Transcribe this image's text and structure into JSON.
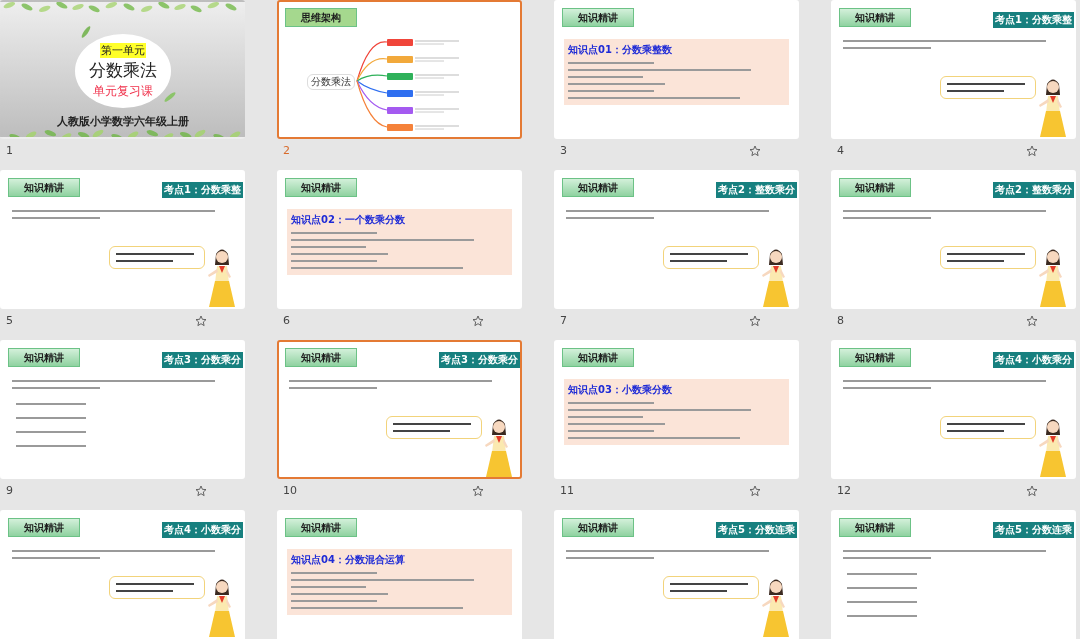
{
  "slides": [
    {
      "number": "1",
      "kind": "title",
      "selected": false,
      "current": false,
      "animated": false,
      "unit": "第一单元",
      "title": "分数乘法",
      "subtitle": "单元复习课",
      "book": "人教版小学数学六年级上册"
    },
    {
      "number": "2",
      "kind": "mindmap",
      "selected": true,
      "current": true,
      "animated": false,
      "header": "思维架构",
      "center": "分数乘法",
      "branches": [
        {
          "color": "#f0453a"
        },
        {
          "color": "#f2a93b"
        },
        {
          "color": "#2fb15a"
        },
        {
          "color": "#2f6ff0"
        },
        {
          "color": "#a45af0"
        },
        {
          "color": "#f5823a"
        }
      ]
    },
    {
      "number": "3",
      "kind": "knowledge",
      "selected": false,
      "current": false,
      "animated": true,
      "header": "知识精讲",
      "point": "知识点01：分数乘整数"
    },
    {
      "number": "4",
      "kind": "example",
      "selected": false,
      "current": false,
      "animated": true,
      "header": "知识精讲",
      "tag": "考点1：分数乘整",
      "figure": true
    },
    {
      "number": "5",
      "kind": "example",
      "selected": false,
      "current": false,
      "animated": true,
      "header": "知识精讲",
      "tag": "考点1：分数乘整",
      "figure": true
    },
    {
      "number": "6",
      "kind": "knowledge",
      "selected": false,
      "current": false,
      "animated": true,
      "header": "知识精讲",
      "point": "知识点02：一个数乘分数"
    },
    {
      "number": "7",
      "kind": "example",
      "selected": false,
      "current": false,
      "animated": true,
      "header": "知识精讲",
      "tag": "考点2：整数乘分",
      "figure": true
    },
    {
      "number": "8",
      "kind": "example",
      "selected": false,
      "current": false,
      "animated": true,
      "header": "知识精讲",
      "tag": "考点2：整数乘分",
      "figure": true
    },
    {
      "number": "9",
      "kind": "example",
      "selected": false,
      "current": false,
      "animated": true,
      "header": "知识精讲",
      "tag": "考点3：分数乘分",
      "figure": false
    },
    {
      "number": "10",
      "kind": "example",
      "selected": true,
      "current": false,
      "animated": true,
      "header": "知识精讲",
      "tag": "考点3：分数乘分",
      "figure": true
    },
    {
      "number": "11",
      "kind": "knowledge",
      "selected": false,
      "current": false,
      "animated": true,
      "header": "知识精讲",
      "point": "知识点03：小数乘分数"
    },
    {
      "number": "12",
      "kind": "example",
      "selected": false,
      "current": false,
      "animated": true,
      "header": "知识精讲",
      "tag": "考点4：小数乘分",
      "figure": true
    },
    {
      "kind": "example",
      "selected": false,
      "header": "知识精讲",
      "tag": "考点4：小数乘分",
      "figure": true
    },
    {
      "kind": "knowledge",
      "selected": false,
      "header": "知识精讲",
      "point": "知识点04：分数混合运算"
    },
    {
      "kind": "example",
      "selected": false,
      "header": "知识精讲",
      "tag": "考点5：分数连乘",
      "figure": true
    },
    {
      "kind": "example",
      "selected": false,
      "header": "知识精讲",
      "tag": "考点5：分数连乘",
      "figure": false
    }
  ]
}
